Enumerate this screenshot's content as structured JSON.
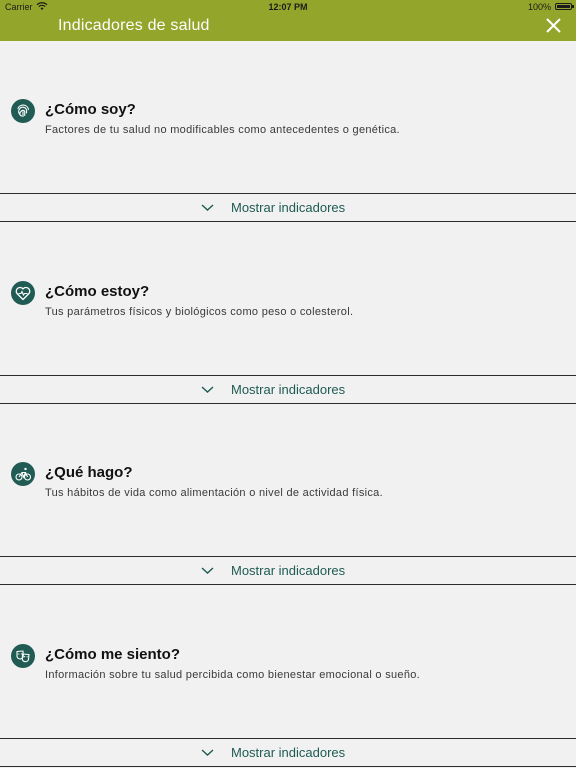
{
  "status_bar": {
    "carrier": "Carrier",
    "time": "12:07 PM",
    "battery": "100%"
  },
  "header": {
    "title": "Indicadores de salud",
    "close_icon": "close-icon"
  },
  "colors": {
    "header": "#93a52a",
    "accent": "#205c54",
    "link": "#1e5b52"
  },
  "sections": [
    {
      "icon": "fingerprint-icon",
      "title": "¿Cómo soy?",
      "description": "Factores de tu salud no modificables como antecedentes o genética.",
      "button_label": "Mostrar indicadores"
    },
    {
      "icon": "heart-pulse-icon",
      "title": "¿Cómo estoy?",
      "description": "Tus parámetros físicos y biológicos como peso o colesterol.",
      "button_label": "Mostrar indicadores"
    },
    {
      "icon": "bicycle-icon",
      "title": "¿Qué hago?",
      "description": "Tus hábitos de vida como alimentación o nivel de actividad física.",
      "button_label": "Mostrar indicadores"
    },
    {
      "icon": "theater-masks-icon",
      "title": "¿Cómo me siento?",
      "description": "Información sobre tu salud percibida como bienestar emocional o sueño.",
      "button_label": "Mostrar indicadores"
    }
  ]
}
